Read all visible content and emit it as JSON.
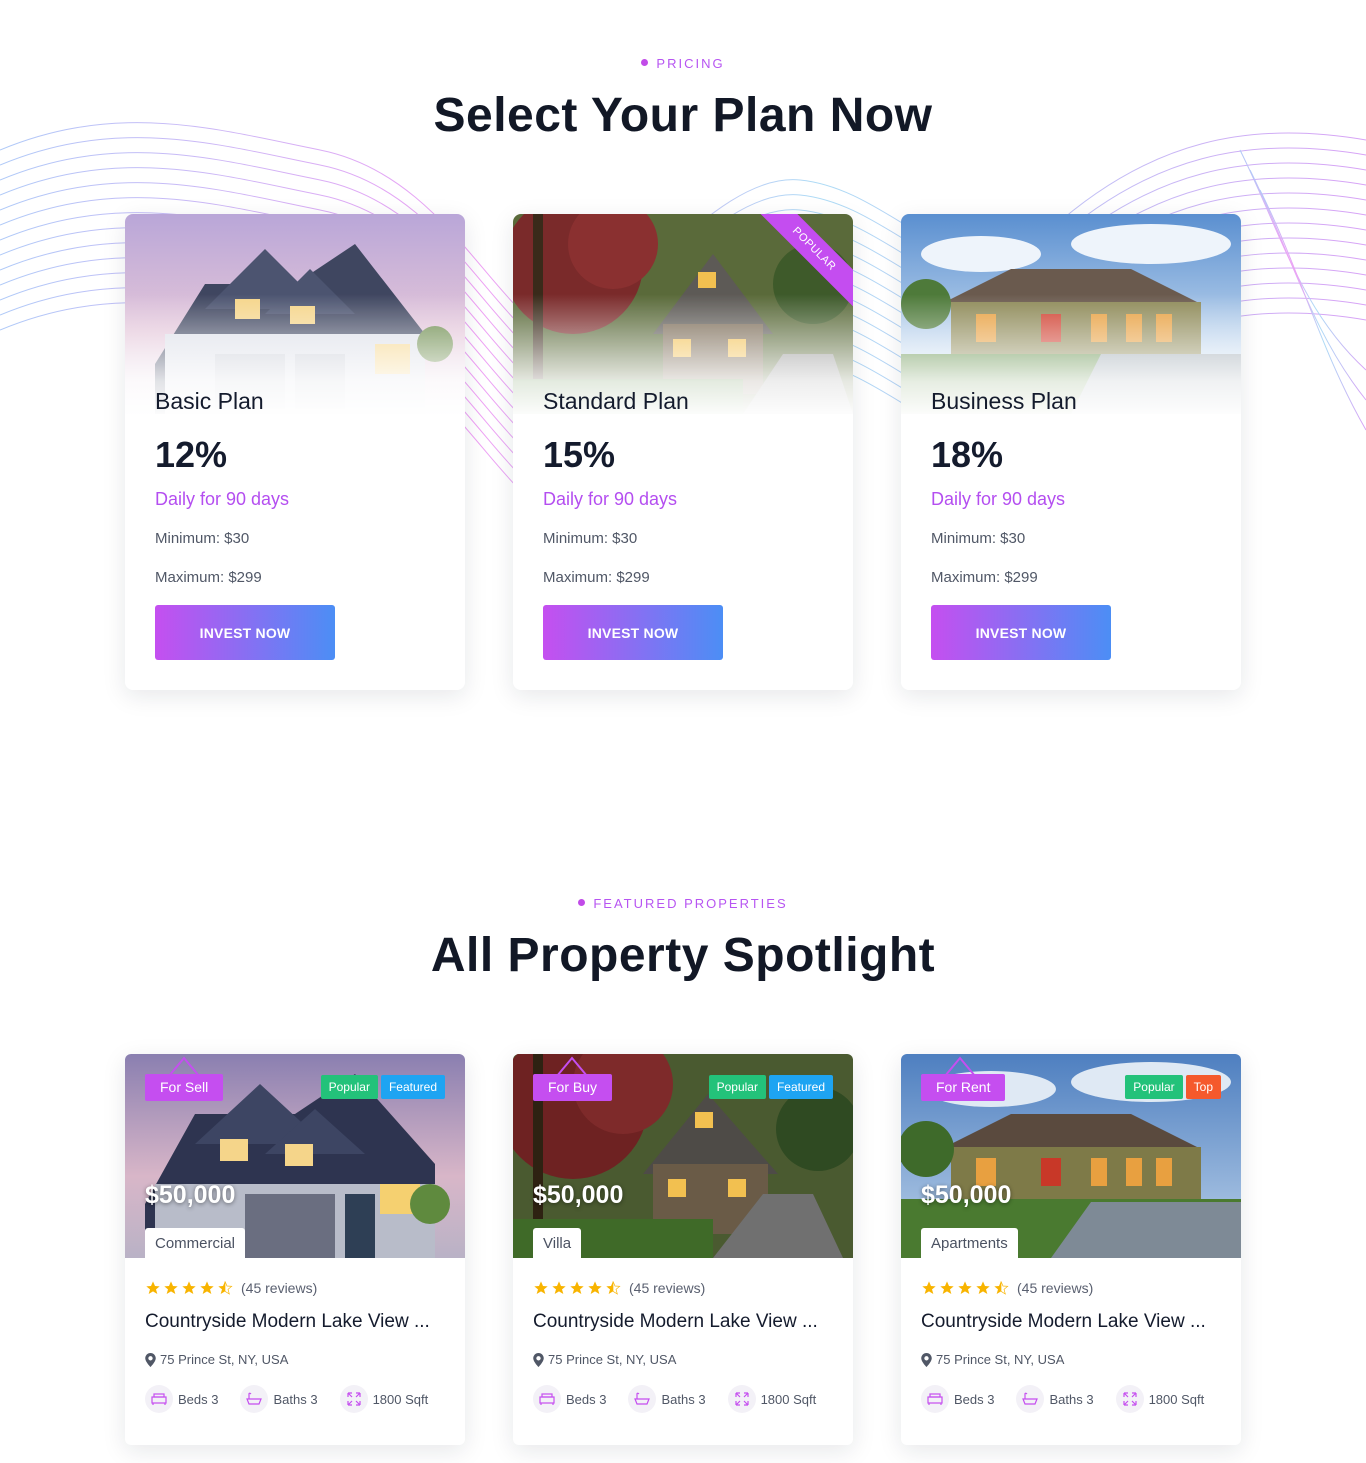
{
  "pricing": {
    "tag": "PRICING",
    "title": "Select Your Plan Now",
    "plans": [
      {
        "name": "Basic Plan",
        "rate": "12%",
        "period": "Daily for 90 days",
        "minimum": "Minimum: $30",
        "maximum": "Maximum: $299",
        "button": "INVEST NOW"
      },
      {
        "name": "Standard Plan",
        "rate": "15%",
        "period": "Daily for 90 days",
        "minimum": "Minimum: $30",
        "maximum": "Maximum: $299",
        "button": "INVEST NOW",
        "ribbon": "POPULAR"
      },
      {
        "name": "Business Plan",
        "rate": "18%",
        "period": "Daily for 90 days",
        "minimum": "Minimum: $30",
        "maximum": "Maximum: $299",
        "button": "INVEST NOW"
      }
    ]
  },
  "properties": {
    "tag": "FEATURED PROPERTIES",
    "title": "All Property Spotlight",
    "items": [
      {
        "status": "For Sell",
        "badges": [
          "Popular",
          "Featured"
        ],
        "price": "$50,000",
        "type": "Commercial",
        "reviews": "(45 reviews)",
        "title": "Countryside Modern Lake View ...",
        "address": "75 Prince St, NY, USA",
        "beds": "Beds 3",
        "baths": "Baths 3",
        "area": "1800 Sqft"
      },
      {
        "status": "For Buy",
        "badges": [
          "Popular",
          "Featured"
        ],
        "price": "$50,000",
        "type": "Villa",
        "reviews": "(45 reviews)",
        "title": "Countryside Modern Lake View ...",
        "address": "75 Prince St, NY, USA",
        "beds": "Beds 3",
        "baths": "Baths 3",
        "area": "1800 Sqft"
      },
      {
        "status": "For Rent",
        "badges": [
          "Popular",
          "Top"
        ],
        "price": "$50,000",
        "type": "Apartments",
        "reviews": "(45 reviews)",
        "title": "Countryside Modern Lake View ...",
        "address": "75 Prince St, NY, USA",
        "beds": "Beds 3",
        "baths": "Baths 3",
        "area": "1800 Sqft"
      }
    ]
  },
  "colors": {
    "accent": "#c54ef0",
    "gradient_end": "#4c8ef5",
    "badge_green": "#23c27a",
    "badge_blue": "#1ea4f2",
    "badge_orange": "#f5592c",
    "star": "#f8b400"
  },
  "icons": {
    "rating": "star-icon",
    "location": "map-pin-icon",
    "beds": "bed-icon",
    "baths": "bathtub-icon",
    "area": "area-expand-icon"
  }
}
